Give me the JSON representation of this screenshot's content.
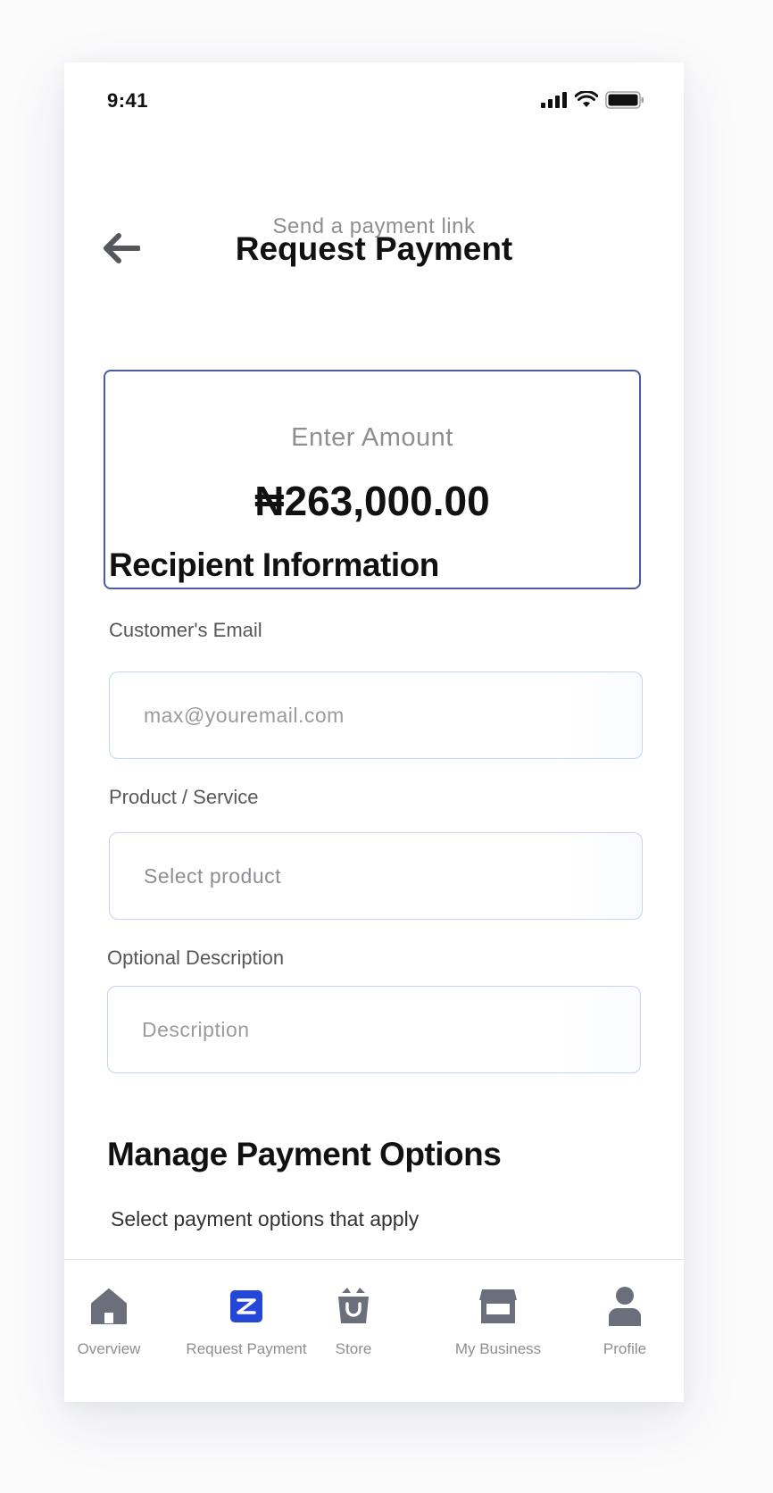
{
  "status_bar": {
    "time": "9:41"
  },
  "header": {
    "title": "Request Payment",
    "subtitle": "Send a payment link",
    "back_icon": "arrow-left-icon"
  },
  "amount": {
    "label": "Enter Amount",
    "value": "₦263,000.00"
  },
  "recipient": {
    "section_title": "Recipient Information",
    "email_label": "Customer's Email",
    "email_placeholder": "max@youremail.com",
    "product_label": "Product / Service",
    "product_placeholder": "Select product",
    "description_label": "Optional Description",
    "description_placeholder": "Description"
  },
  "payment_options": {
    "section_title": "Manage Payment Options",
    "hint": "Select payment options that apply"
  },
  "tab_bar": {
    "items": [
      {
        "label": "Overview",
        "icon": "home-icon",
        "active": false
      },
      {
        "label": "Request Payment",
        "icon": "request-payment-icon",
        "active": true
      },
      {
        "label": "Store",
        "icon": "store-bag-icon",
        "active": false
      },
      {
        "label": "My Business",
        "icon": "storefront-icon",
        "active": false
      },
      {
        "label": "Profile",
        "icon": "user-icon",
        "active": false
      }
    ]
  },
  "colors": {
    "accent": "#2447d8",
    "card_border": "#4c5a9e",
    "input_border": "#c6d3f3",
    "tab_icon_inactive": "#6b6f7b"
  }
}
